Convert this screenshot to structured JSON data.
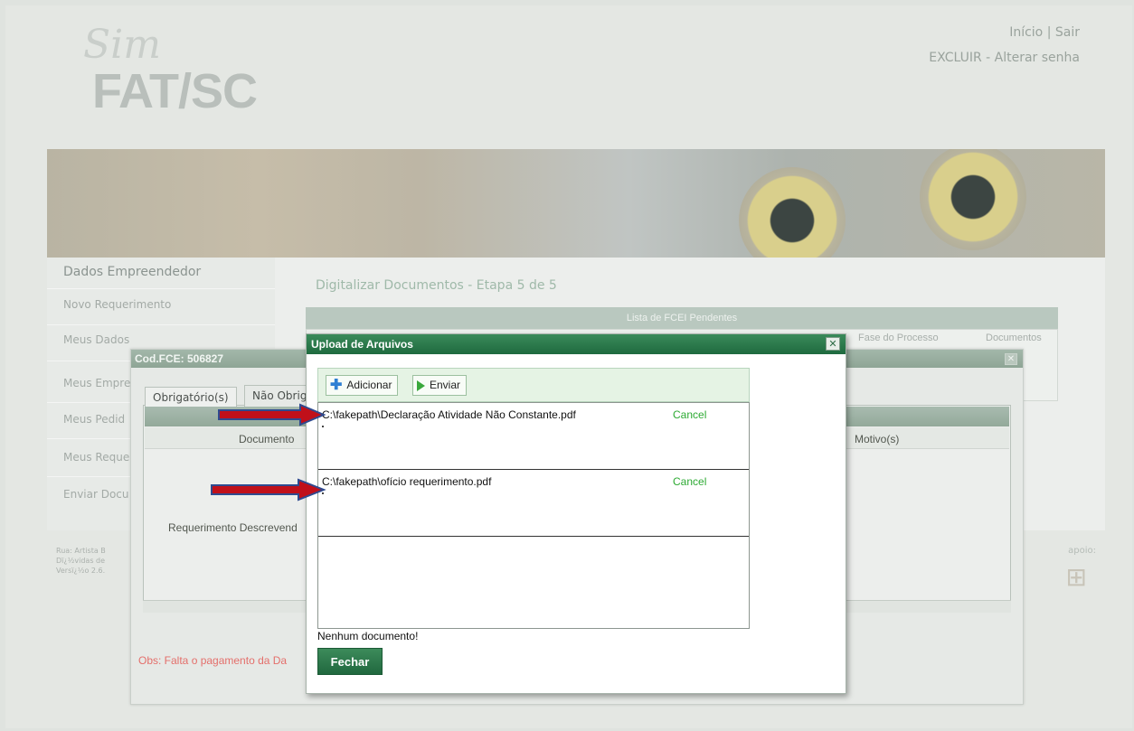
{
  "header": {
    "logo_script": "Sim",
    "logo_main": "FAT/SC",
    "link_inicio": "Início",
    "link_sair": "Sair",
    "link_excluir": "EXCLUIR",
    "link_alterar_senha": "Alterar senha"
  },
  "sidebar": {
    "title": "Dados Empreendedor",
    "items": [
      {
        "label": "Novo Requerimento"
      },
      {
        "label": "Meus Dados"
      },
      {
        "label": "Meus Empre"
      },
      {
        "label": "Meus Pedid"
      },
      {
        "label": "Meus Reque"
      },
      {
        "label": "Enviar Docu"
      }
    ]
  },
  "main": {
    "step_title": "Digitalizar Documentos - Etapa 5 de 5",
    "list_title": "Lista de FCEI Pendentes",
    "col_fase": "Fase do Processo",
    "col_documentos": "Documentos"
  },
  "footer": {
    "line1": "Rua: Artista B",
    "line2": "Dï¿½vidas de",
    "line3": "Versï¿½o 2.6.",
    "apoio": "apoio:"
  },
  "back_dialog": {
    "title": "Cod.FCE: 506827",
    "tab_obrigatorio": "Obrigatório(s)",
    "tab_nao_obrigatorio": "Não Obrig",
    "col_documento": "Documento",
    "col_motivo": "Motivo(s)",
    "row_text": "Requerimento Descrevend",
    "obs": "Obs: Falta o pagamento da Da"
  },
  "upload_dialog": {
    "title": "Upload de Arquivos",
    "btn_adicionar": "Adicionar",
    "btn_enviar": "Enviar",
    "files": [
      {
        "name": "C:\\fakepath\\Declaração Atividade Não Constante.pdf",
        "cancel": "Cancel"
      },
      {
        "name": "C:\\fakepath\\ofício requerimento.pdf",
        "cancel": "Cancel"
      }
    ],
    "status": "Nenhum documento!",
    "btn_fechar": "Fechar"
  },
  "colors": {
    "dialog_title_green": "#1f6a3f",
    "cancel_green": "#2daa33",
    "arrow_red": "#c0101a",
    "arrow_blue": "#2f4a8f",
    "obs_red": "#e46f6b"
  }
}
